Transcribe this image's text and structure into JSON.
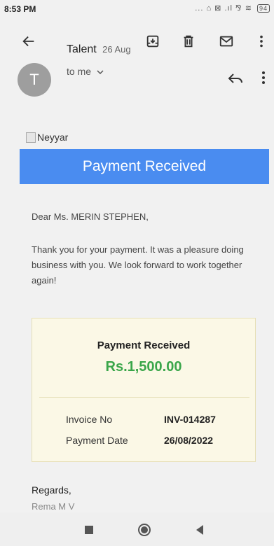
{
  "status": {
    "time": "8:53 PM",
    "indicators": "... ⌂ ⊠ .ıl ⅋ ≋",
    "battery": "94"
  },
  "toolbar": {
    "icons": [
      "back-arrow-icon",
      "archive-icon",
      "delete-icon",
      "mail-icon",
      "more-vert-icon"
    ]
  },
  "sender": {
    "avatar_letter": "T",
    "name": "Talent",
    "date": "26 Aug",
    "recipient": "to me"
  },
  "email": {
    "image_alt": "Neyyar",
    "banner": "Payment Received",
    "greeting": "Dear Ms. MERIN STEPHEN,",
    "body": "Thank you for your payment. It was a pleasure doing business with you. We look forward to work together again!",
    "receipt": {
      "title": "Payment Received",
      "amount": "Rs.1,500.00",
      "rows": [
        {
          "label": "Invoice No",
          "value": "INV-014287"
        },
        {
          "label": "Payment Date",
          "value": "26/08/2022"
        }
      ]
    },
    "regards": "Regards,",
    "signature": "Rema M V"
  },
  "colors": {
    "banner": "#4a8cf0",
    "amount": "#3aa64a",
    "receipt_bg": "#fbf8e6",
    "background": "#f1f1f1"
  }
}
